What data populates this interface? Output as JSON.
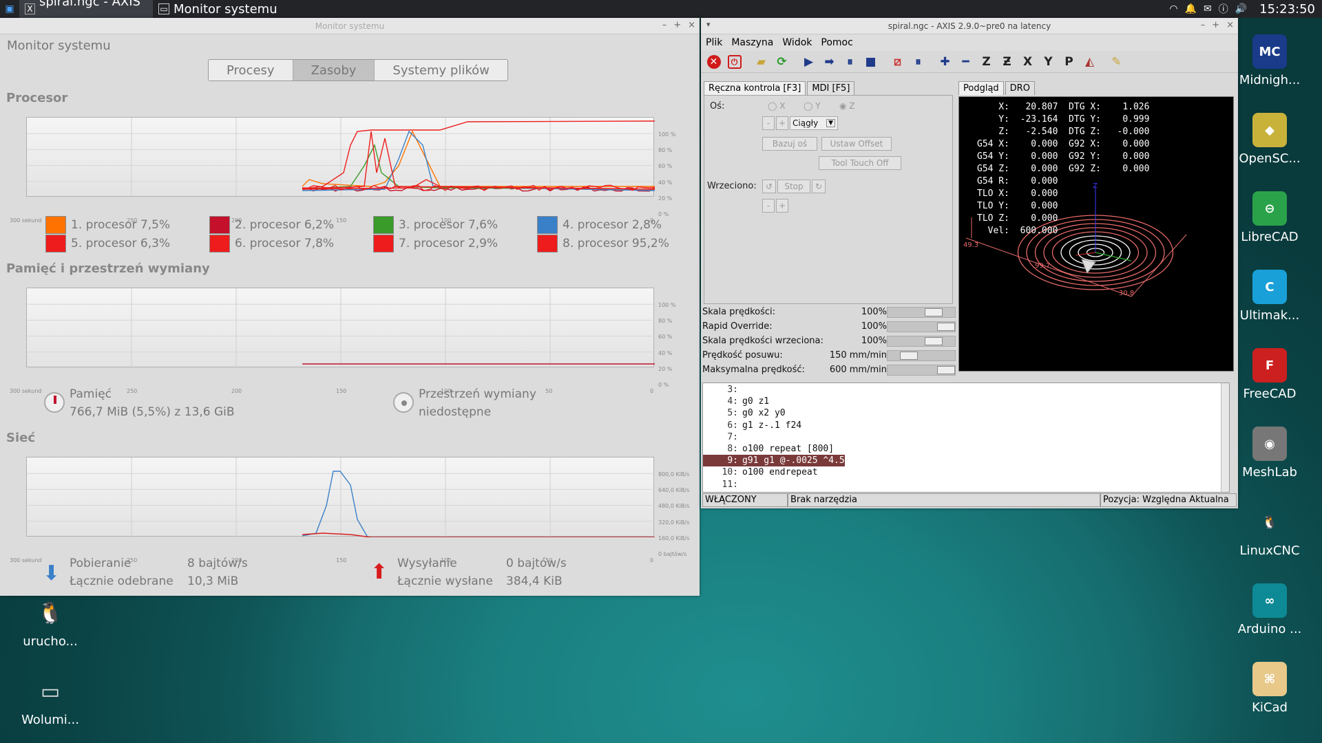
{
  "taskbar": {
    "tasks": [
      {
        "label": "spiral.ngc - AXIS ...",
        "icon": "X"
      },
      {
        "label": "Monitor systemu"
      }
    ],
    "clock": "15:23:50"
  },
  "sysmon": {
    "window_title": "Monitor systemu",
    "app_title": "Monitor systemu",
    "tabs": [
      "Procesy",
      "Zasoby",
      "Systemy plików"
    ],
    "selected_tab": "Zasoby",
    "cpu": {
      "title": "Procesor",
      "legend": [
        {
          "label": "1. procesor 7,5%",
          "color": "#ff7200"
        },
        {
          "label": "2. procesor 6,2%",
          "color": "#c4102a"
        },
        {
          "label": "3. procesor 7,6%",
          "color": "#3a9a2a"
        },
        {
          "label": "4. procesor 2,8%",
          "color": "#3a80c8"
        },
        {
          "label": "5. procesor 6,3%",
          "color": "#ee1c1c"
        },
        {
          "label": "6. procesor 7,8%",
          "color": "#ee1c1c"
        },
        {
          "label": "7. procesor 2,9%",
          "color": "#ee1c1c"
        },
        {
          "label": "8. procesor 95,2%",
          "color": "#ee1c1c"
        }
      ]
    },
    "mem": {
      "title": "Pamięć i przestrzeń wymiany",
      "memory_label": "Pamięć",
      "memory_value": "766,7 MiB (5,5%) z 13,6 GiB",
      "swap_label": "Przestrzeń wymiany",
      "swap_value": "niedostępne"
    },
    "net": {
      "title": "Sieć",
      "down_label": "Pobieranie",
      "down_rate": "8 bajtów/s",
      "down_total_label": "Łącznie odebrane",
      "down_total": "10,3 MiB",
      "up_label": "Wysyłanie",
      "up_rate": "0 bajtów/s",
      "up_total_label": "Łącznie wysłane",
      "up_total": "384,4 KiB"
    },
    "x_ticks": [
      "300 sekund",
      "250",
      "200",
      "150",
      "100",
      "50",
      "0"
    ],
    "pct_ticks": [
      "100 %",
      "80 %",
      "60 %",
      "40 %",
      "20 %",
      "0 %"
    ],
    "net_ticks": [
      "800,0 KiB/s",
      "640,0 KiB/s",
      "480,0 KiB/s",
      "320,0 KiB/s",
      "160,0 KiB/s",
      "0 bajtów/s"
    ]
  },
  "axis": {
    "window_title": "spiral.ngc - AXIS 2.9.0~pre0 na latency",
    "menu": [
      "Plik",
      "Maszyna",
      "Widok",
      "Pomoc"
    ],
    "tabs_left": [
      "Ręczna kontrola [F3]",
      "MDI [F5]"
    ],
    "tabs_right": [
      "Podgląd",
      "DRO"
    ],
    "axis_label": "Oś:",
    "axes": [
      "X",
      "Y",
      "Z"
    ],
    "jog_mode": "Ciągły",
    "home_btn": "Bazuj oś",
    "offset_btn": "Ustaw Offset",
    "touch_btn": "Tool Touch Off",
    "spindle_label": "Wrzeciono:",
    "stop_btn": "Stop",
    "sliders": [
      {
        "label": "Skala prędkości:",
        "value": "100%",
        "level": 0.75
      },
      {
        "label": "Rapid Override:",
        "value": "100%",
        "level": 1.0
      },
      {
        "label": "Skala prędkości wrzeciona:",
        "value": "100%",
        "level": 0.75
      },
      {
        "label": "Prędkość posuwu:",
        "value": "150 mm/min",
        "level": 0.25
      },
      {
        "label": "Maksymalna prędkość:",
        "value": "600 mm/min",
        "level": 1.0
      }
    ],
    "dro": [
      "    X:   20.807  DTG X:    1.026",
      "    Y:  -23.164  DTG Y:    0.999",
      "    Z:   -2.540  DTG Z:   -0.000",
      "G54 X:    0.000  G92 X:    0.000",
      "G54 Y:    0.000  G92 Y:    0.000",
      "G54 Z:    0.000  G92 Z:    0.000",
      "G54 R:    0.000",
      "TLO X:    0.000",
      "TLO Y:    0.000",
      "TLO Z:    0.000",
      "  Vel:  600.000"
    ],
    "preview_labels": [
      "Z",
      "99.7",
      "49.3",
      "30.8"
    ],
    "gcode": [
      {
        "no": "3:",
        "code": ""
      },
      {
        "no": "4:",
        "code": "g0 z1"
      },
      {
        "no": "5:",
        "code": "g0 x2 y0"
      },
      {
        "no": "6:",
        "code": "g1 z-.1 f24"
      },
      {
        "no": "7:",
        "code": ""
      },
      {
        "no": "8:",
        "code": "o100 repeat [800]"
      },
      {
        "no": "9:",
        "code": "g91 g1 @-.0025 ^4.5"
      },
      {
        "no": "10:",
        "code": "o100 endrepeat"
      },
      {
        "no": "11:",
        "code": ""
      }
    ],
    "highlight_line": 6,
    "status": [
      "WŁĄCZONY",
      "Brak narzędzia",
      "Pozycja: Względna Aktualna"
    ]
  },
  "desktop": {
    "right_icons": [
      {
        "label": "Midnigh...",
        "glyph": "MC",
        "color": "#1a3a8a"
      },
      {
        "label": "OpenSC...",
        "glyph": "◆",
        "color": "#c9b23a"
      },
      {
        "label": "LibreCAD",
        "glyph": "⊖",
        "color": "#2aa24a"
      },
      {
        "label": "Ultimak...",
        "glyph": "C",
        "color": "#1aa0d8"
      },
      {
        "label": "FreeCAD",
        "glyph": "F",
        "color": "#cc2020"
      },
      {
        "label": "MeshLab",
        "glyph": "◉",
        "color": "#777"
      },
      {
        "label": "LinuxCNC",
        "glyph": "🐧",
        "color": "transparent"
      },
      {
        "label": "Arduino ...",
        "glyph": "∞",
        "color": "#0e8a96"
      },
      {
        "label": "KiCad",
        "glyph": "⌘",
        "color": "#e8c98a"
      }
    ],
    "left_icons": [
      {
        "label": "urucho...",
        "glyph": "🐧"
      },
      {
        "label": "Wolumi...",
        "glyph": "▭"
      }
    ]
  }
}
